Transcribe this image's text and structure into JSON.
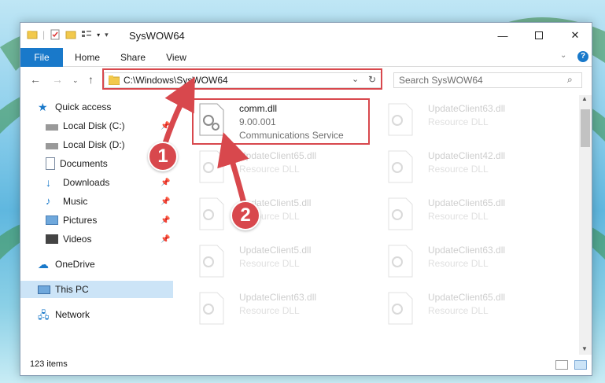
{
  "window": {
    "title": "SysWOW64",
    "minimize_icon": "minimize-icon",
    "maximize_icon": "maximize-icon",
    "close_icon": "close-icon"
  },
  "ribbon": {
    "tabs": [
      {
        "label": "File"
      },
      {
        "label": "Home"
      },
      {
        "label": "Share"
      },
      {
        "label": "View"
      }
    ]
  },
  "address": {
    "path": "C:\\Windows\\SysWOW64",
    "search_placeholder": "Search SysWOW64"
  },
  "sidebar": {
    "items": [
      {
        "label": "Quick access",
        "icon": "star-icon",
        "pinned": false
      },
      {
        "label": "Local Disk (C:)",
        "icon": "drive-icon",
        "pinned": true
      },
      {
        "label": "Local Disk (D:)",
        "icon": "drive-icon",
        "pinned": false
      },
      {
        "label": "Documents",
        "icon": "document-icon",
        "pinned": true
      },
      {
        "label": "Downloads",
        "icon": "download-icon",
        "pinned": true
      },
      {
        "label": "Music",
        "icon": "music-icon",
        "pinned": true
      },
      {
        "label": "Pictures",
        "icon": "pictures-icon",
        "pinned": true
      },
      {
        "label": "Videos",
        "icon": "videos-icon",
        "pinned": true
      },
      {
        "label": "OneDrive",
        "icon": "cloud-icon",
        "pinned": false
      },
      {
        "label": "This PC",
        "icon": "computer-icon",
        "pinned": false,
        "selected": true
      },
      {
        "label": "Network",
        "icon": "network-icon",
        "pinned": false
      }
    ]
  },
  "files": [
    {
      "name": "comm.dll",
      "version": "9.00.001",
      "description": "Communications Service"
    },
    {
      "name": "UpdateClient63.dll",
      "description": "Resource DLL"
    },
    {
      "name": "UpdateClient65.dll",
      "description": "Resource DLL"
    },
    {
      "name": "UpdateClient42.dll",
      "description": "Resource DLL"
    },
    {
      "name": "UpdateClient5.dll",
      "description": "Resource DLL"
    },
    {
      "name": "UpdateClient65.dll",
      "description": "Resource DLL"
    },
    {
      "name": "UpdateClient5.dll",
      "description": "Resource DLL"
    },
    {
      "name": "UpdateClient63.dll",
      "description": "Resource DLL"
    },
    {
      "name": "UpdateClient63.dll",
      "description": "Resource DLL"
    },
    {
      "name": "UpdateClient65.dll",
      "description": "Resource DLL"
    }
  ],
  "status": {
    "item_count": "123 items"
  },
  "annotations": {
    "badge1": "1",
    "badge2": "2",
    "color": "#d8484d"
  }
}
